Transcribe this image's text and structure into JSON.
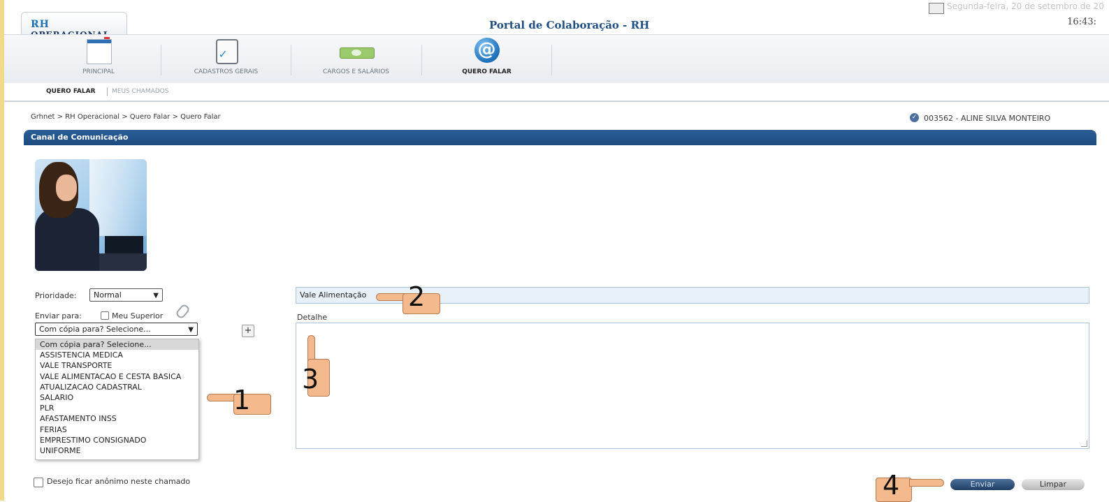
{
  "header": {
    "logo_prefix": "RH",
    "logo_text": "OPERACIONAL",
    "portal_title": "Portal de Colaboração - RH",
    "time": "16:43:",
    "date_partial": "Segunda-feira, 20 de setembro de 20"
  },
  "menu": {
    "items": [
      {
        "label": "PRINCIPAL",
        "icon": "calendar-icon"
      },
      {
        "label": "CADASTROS GERAIS",
        "icon": "document-check-icon"
      },
      {
        "label": "CARGOS E SALÁRIOS",
        "icon": "money-icon"
      },
      {
        "label": "QUERO FALAR",
        "icon": "at-sign-icon",
        "active": true
      }
    ]
  },
  "submenu": {
    "active": "QUERO FALAR",
    "other": "MEUS CHAMADOS"
  },
  "breadcrumb": "Grhnet > RH Operacional > Quero Falar > Quero Falar",
  "user": {
    "id_name": "003562 - ALINE SILVA MONTEIRO"
  },
  "panel": {
    "title": "Canal de Comunicação"
  },
  "form": {
    "priority_label": "Prioridade:",
    "priority_value": "Normal",
    "send_to_label": "Enviar para:",
    "superior_label": "Meu Superior",
    "cc_value": "Com cópia para? Selecione...",
    "subject_value": "Vale Alimentação",
    "detail_label": "Detalhe",
    "anon_label": "Desejo ficar anônimo neste chamado",
    "send_button": "Enviar",
    "clear_button": "Limpar"
  },
  "dropdown_options": [
    "Com cópia para? Selecione...",
    "ASSISTENCIA MEDICA",
    "VALE TRANSPORTE",
    "VALE ALIMENTACAO E CESTA BASICA",
    "ATUALIZACAO CADASTRAL",
    "SALARIO",
    "PLR",
    "AFASTAMENTO INSS",
    "FERIAS",
    "EMPRESTIMO CONSIGNADO",
    "UNIFORME"
  ],
  "annotations": {
    "step1": "1",
    "step2": "2",
    "step3": "3",
    "step4": "4"
  },
  "colors": {
    "header_blue": "#1b4b80",
    "hand_fill": "#f4b98d",
    "send_button": "#1f3e66"
  }
}
